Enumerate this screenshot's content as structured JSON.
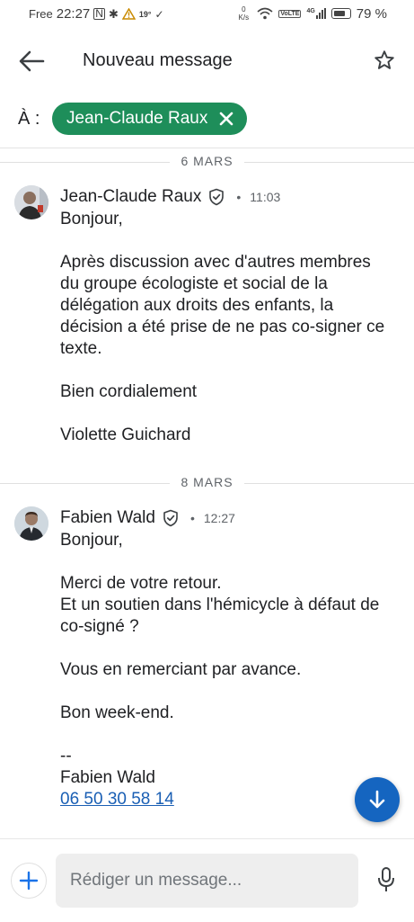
{
  "status_bar": {
    "carrier": "Free",
    "time": "22:27",
    "temperature": "19°",
    "net_speed_value": "0",
    "net_speed_unit": "K/s",
    "volte": "VoLTE",
    "signal_type": "4G",
    "battery": "79 %"
  },
  "header": {
    "title": "Nouveau message"
  },
  "recipient": {
    "label": "À :",
    "name": "Jean-Claude Raux"
  },
  "thread": [
    {
      "date": "6 MARS",
      "sender": "Jean-Claude Raux",
      "time": "11:03",
      "paragraphs": [
        "Bonjour,",
        "Après discussion avec d'autres membres du groupe écologiste et social de la délégation aux droits des enfants, la décision a été prise de ne pas co-signer ce texte.",
        "Bien cordialement",
        "Violette Guichard"
      ]
    },
    {
      "date": "8 MARS",
      "sender": "Fabien Wald",
      "time": "12:27",
      "line1": "Bonjour,",
      "line2": "Merci de votre retour.",
      "line3": "Et un soutien dans l'hémicycle à défaut de co-signé ?",
      "line4": "Vous en remerciant par avance.",
      "line5": "Bon week-end.",
      "signature_dash": "--",
      "signature_name": "Fabien Wald",
      "phone": "06 50 30 58 14"
    }
  ],
  "compose": {
    "placeholder": "Rédiger un message..."
  },
  "colors": {
    "chip": "#1e8e5a",
    "fab": "#1565c0",
    "link": "#1a5fb4"
  },
  "icons": [
    "back-arrow-icon",
    "star-icon",
    "close-icon",
    "verified-icon",
    "arrow-down-icon",
    "plus-icon",
    "microphone-icon"
  ]
}
